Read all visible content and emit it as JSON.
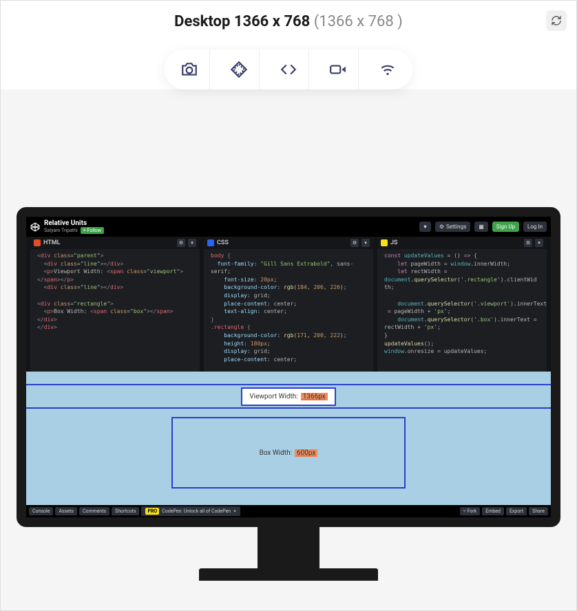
{
  "header": {
    "title_main": "Desktop 1366 x 768",
    "title_dims": "(1366 x 768 )"
  },
  "codepen": {
    "pen_title": "Relative Units",
    "author": "Satyam Tripathi",
    "follow_label": "+ Follow",
    "buttons": {
      "settings": "Settings",
      "signup": "Sign Up",
      "login": "Log In"
    },
    "panes": {
      "html": {
        "label": "HTML"
      },
      "css": {
        "label": "CSS"
      },
      "js": {
        "label": "JS"
      }
    },
    "preview": {
      "vw_label": "Viewport Width:",
      "vw_value": "1366px",
      "box_label": "Box Width:",
      "box_value": "600px"
    },
    "footer": {
      "console": "Console",
      "assets": "Assets",
      "comments": "Comments",
      "shortcuts": "Shortcuts",
      "promo": "CodePen: Unlock all of CodePen",
      "fork": "Fork",
      "embed": "Embed",
      "export": "Export",
      "share": "Share"
    },
    "code": {
      "html_lines": "<div class=\"parent\">\n  <div class=\"line\"></div>\n  <p>Viewport Width: <span class=\"viewport\">\n</span></p>\n  <div class=\"line\"></div>\n\n<div class=\"rectangle\">\n  <p>Box Width: <span class=\"box\"></span>\n</div>\n</div>",
      "css_lines": "body {\n  font-family: \"Gill Sans Extrabold\", sans-serif;\n    font-size: 20px;\n    background-color: rgb(184, 206, 226);\n    display: grid;\n    place-content: center;\n    text-align: center;\n}\n.rectangle {\n    background-color: rgb(171, 200, 222);\n    height: 180px;\n    display: grid;\n    place-content: center;",
      "js_lines": "const updateValues = () => {\n    let pageWidth = window.innerWidth;\n    let rectWidth = \ndocument.querySelector('.rectangle').clientWidth;\n\n    document.querySelector('.viewport').innerText = pageWidth + 'px';\n    document.querySelector('.box').innerText = rectWidth + 'px';\n}\nupdateValues();\nwindow.onresize = updateValues;"
    }
  }
}
